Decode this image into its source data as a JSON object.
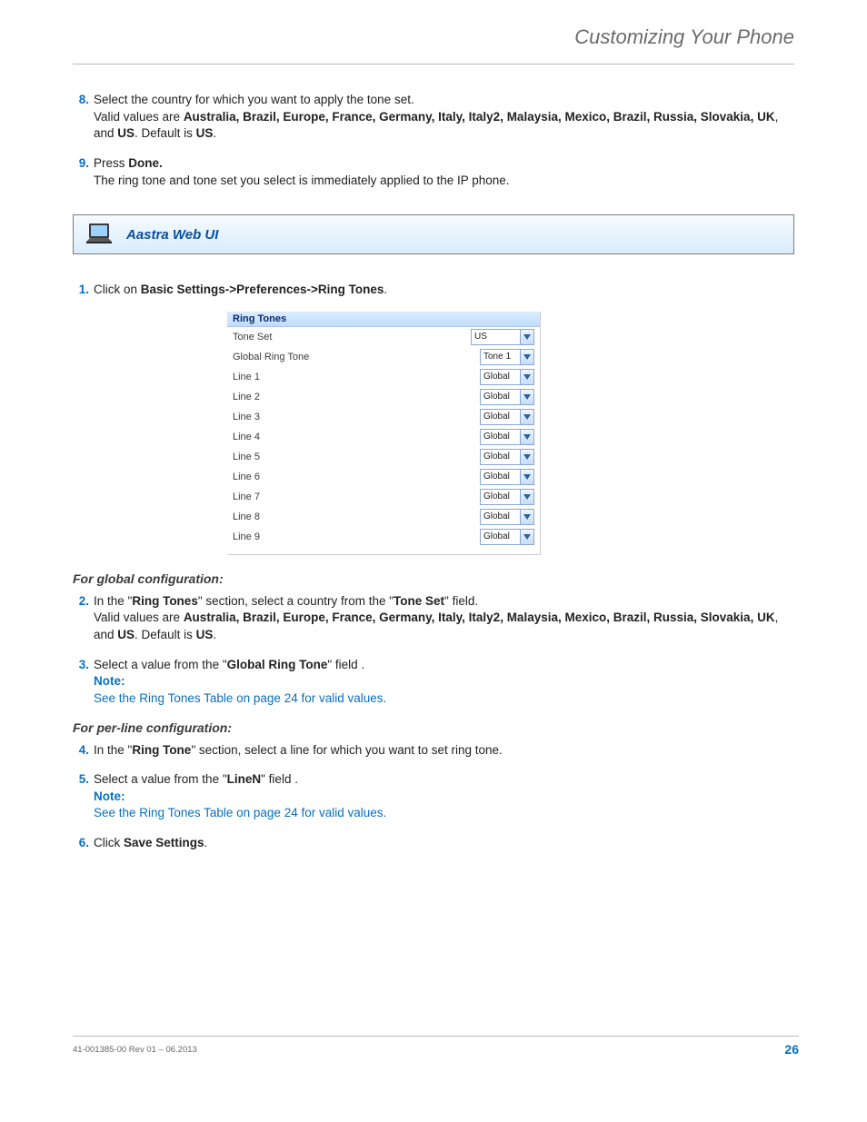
{
  "header": {
    "title": "Customizing Your Phone"
  },
  "steps_top": {
    "s8": {
      "num": "8.",
      "line1a": "Select the country for which you want to apply the tone set.",
      "line2_pre": "Valid values are ",
      "countries": "Australia, Brazil, Europe, France, Germany, Italy, Italy2, Malaysia, Mexico, Brazil, Russia, Slovakia, UK",
      "line2_mid": ", and ",
      "us": "US",
      "line2_post": ". Default is ",
      "us2": "US",
      "line2_end": "."
    },
    "s9": {
      "num": "9.",
      "line1_pre": "Press ",
      "done": "Done.",
      "line2": "The ring tone and tone set you select is immediately applied to the IP phone."
    }
  },
  "banner": {
    "title": "Aastra Web UI"
  },
  "steps_mid": {
    "s1": {
      "num": "1.",
      "pre": "Click on ",
      "bold": "Basic Settings->Preferences->Ring Tones",
      "post": "."
    }
  },
  "ui": {
    "header": "Ring Tones",
    "rows": [
      {
        "label": "Tone Set",
        "value": "US",
        "wide": true
      },
      {
        "label": "Global Ring Tone",
        "value": "Tone 1"
      },
      {
        "label": "Line 1",
        "value": "Global"
      },
      {
        "label": "Line 2",
        "value": "Global"
      },
      {
        "label": "Line 3",
        "value": "Global"
      },
      {
        "label": "Line 4",
        "value": "Global"
      },
      {
        "label": "Line 5",
        "value": "Global"
      },
      {
        "label": "Line 6",
        "value": "Global"
      },
      {
        "label": "Line 7",
        "value": "Global"
      },
      {
        "label": "Line 8",
        "value": "Global"
      },
      {
        "label": "Line 9",
        "value": "Global"
      }
    ]
  },
  "subheads": {
    "global": "For global configuration:",
    "perline": "For per-line configuration:"
  },
  "steps_bottom": {
    "s2": {
      "num": "2.",
      "l1_a": "In the \"",
      "l1_b": "Ring Tones",
      "l1_c": "\" section, select a country from the \"",
      "l1_d": "Tone Set",
      "l1_e": "\" field.",
      "l2_pre": "Valid values are ",
      "countries": "Australia, Brazil, Europe, France, Germany, Italy, Italy2, Malaysia, Mexico, Brazil, Russia, Slovakia, UK",
      "l2_mid": ", and ",
      "us": "US",
      "l2_post": ". Default is ",
      "us2": "US",
      "l2_end": "."
    },
    "s3": {
      "num": "3.",
      "l1_a": "Select a value from the \"",
      "l1_b": "Global Ring Tone",
      "l1_c": "\" field .",
      "note": "Note:",
      "see_a": "See the ",
      "link": "Ring Tones Table",
      "see_b": " on ",
      "page": "page 24",
      "see_c": " for valid values."
    },
    "s4": {
      "num": "4.",
      "l1_a": "In the \"",
      "l1_b": "Ring Tone",
      "l1_c": "\" section, select a line for which you want to set ring tone."
    },
    "s5": {
      "num": "5.",
      "l1_a": "Select a value from the \"",
      "l1_b": "LineN",
      "l1_c": "\" field .",
      "note": "Note:",
      "see_a": "See the ",
      "link": "Ring Tones Table",
      "see_b": " on ",
      "page": "page 24",
      "see_c": " for valid values."
    },
    "s6": {
      "num": "6.",
      "l1_a": "Click ",
      "l1_b": "Save Settings",
      "l1_c": "."
    }
  },
  "footer": {
    "left": "41-001385-00 Rev 01 – 06.2013",
    "page": "26"
  }
}
